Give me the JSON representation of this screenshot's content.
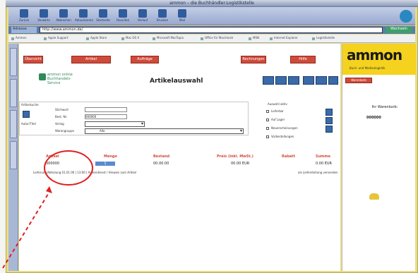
{
  "window": {
    "title": "ammon – die Buchhändler-Logistikstelle"
  },
  "toolbar": {
    "buttons": [
      {
        "label": "Zurück",
        "icon": "back-icon"
      },
      {
        "label": "Vorwärts",
        "icon": "forward-icon"
      },
      {
        "label": "Abbrechen",
        "icon": "stop-icon"
      },
      {
        "label": "Aktualisieren",
        "icon": "reload-icon"
      },
      {
        "label": "Startseite",
        "icon": "home-icon"
      },
      {
        "label": "Favoriten",
        "icon": "favorites-icon"
      },
      {
        "label": "Verlauf",
        "icon": "history-icon"
      },
      {
        "label": "Drucken",
        "icon": "print-icon"
      },
      {
        "label": "Mail",
        "icon": "mail-icon"
      }
    ]
  },
  "address": {
    "label": "Adresse",
    "value": "http://www.ammon.de/",
    "go_label": "Wechseln"
  },
  "bookmarks": [
    "Ammon",
    "Apple Support",
    "Apple Store",
    "Mac OS X",
    "Microsoft MacTopia",
    "Office für Macintosh",
    "MSN",
    "Internet Explorer",
    "Logistikstelle"
  ],
  "nav": {
    "buttons": [
      "Übersicht",
      "Artikel",
      "Aufträge",
      "Rechnungen",
      "Hilfe"
    ]
  },
  "small_logo": {
    "text": "ammon online Buchhandels-Service"
  },
  "page_title": "Artikelauswahl",
  "filter": {
    "label_search": "Artikelsuche",
    "label_keyword": "Stichwort",
    "label_number": "Best.-Nr.",
    "label_author": "Autor/Titel",
    "label_publisher": "Verlag",
    "label_group": "Warengruppe",
    "field_value": "000000",
    "select_value": "Alle"
  },
  "right_filter": {
    "title": "Auswahl aktiv",
    "opt1": "Lieferbar",
    "opt2": "Auf Lager",
    "opt3": "Neuerscheinungen",
    "opt4": "Vorbestellungen"
  },
  "grid": {
    "headers": [
      "Artikel",
      "Menge",
      "Bestand",
      "Preis (inkl. MwSt.)",
      "Rabatt",
      "Summe"
    ],
    "row": [
      "000000",
      "1",
      "00.00.00",
      "00.00 EUR",
      "",
      "0.00 EUR"
    ],
    "detail": "Lieferung/Abholung 01.01.00 | 13:00 | Außendienst / Hinweis zum Artikel",
    "detail_right": "als Lieferstellung versenden"
  },
  "brand": {
    "name": "ammon",
    "sub": "Buch- und Medienlogistik",
    "button": "Warenkorb"
  },
  "right_panel": {
    "label": "Ihr Warenkorb:",
    "value": "000000"
  },
  "colors": {
    "accent": "#d04a3a",
    "brand": "#f4d21e",
    "toolbar": "#98a8cf"
  }
}
